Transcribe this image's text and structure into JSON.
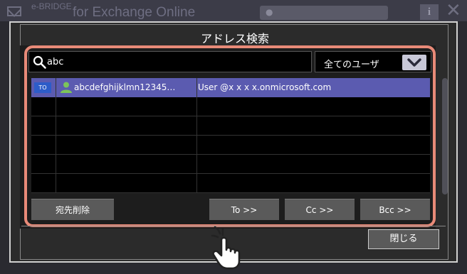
{
  "background_app": {
    "logo": "e-BRIDGE",
    "title": "for Exchange Online",
    "info_label": "i",
    "close_label": "✕"
  },
  "dialog": {
    "title": "アドレス検索"
  },
  "search": {
    "value": "abc"
  },
  "filter": {
    "selected": "全てのユーザ"
  },
  "results": [
    {
      "badge": "TO",
      "name": "abcdefghijklmn12345…",
      "email": "User @x x x x.onmicrosoft.com",
      "selected": true
    }
  ],
  "buttons": {
    "delete": "宛先削除",
    "to": "To >>",
    "cc": "Cc >>",
    "bcc": "Bcc >>",
    "close": "閉じる"
  },
  "colors": {
    "highlight": "#e88a78",
    "selected_row": "#5b5bb0",
    "to_badge": "#2d5cc8",
    "person_icon": "#7cc45a"
  }
}
